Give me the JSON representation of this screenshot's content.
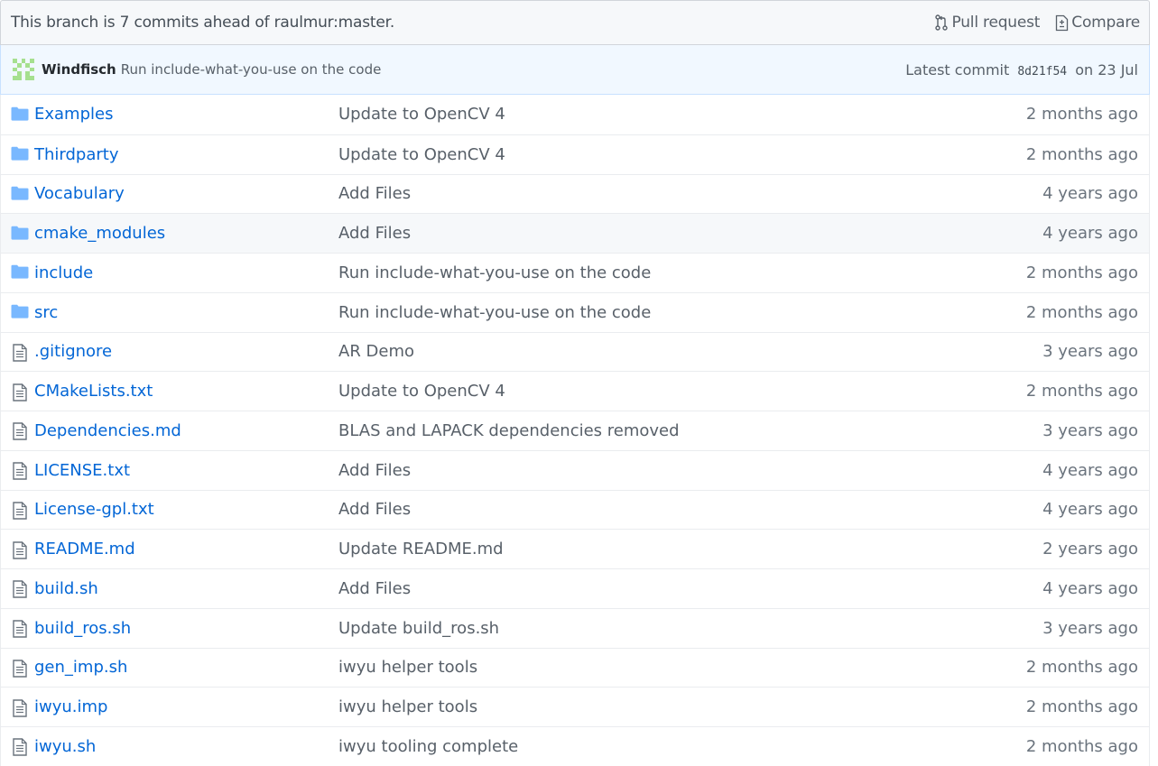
{
  "branch_bar": {
    "message": "This branch is 7 commits ahead of raulmur:master.",
    "pull_request_label": "Pull request",
    "pull_request_icon": "git-pull-request-icon",
    "compare_label": "Compare",
    "compare_icon": "file-diff-icon"
  },
  "commit": {
    "author": "Windfisch",
    "message": "Run include-what-you-use on the code",
    "latest_label": "Latest commit",
    "sha": "8d21f54",
    "date": "on 23 Jul"
  },
  "files": [
    {
      "type": "folder",
      "icon": "folder-icon",
      "name": "Examples",
      "message": "Update to OpenCV 4",
      "age": "2 months ago"
    },
    {
      "type": "folder",
      "icon": "folder-icon",
      "name": "Thirdparty",
      "message": "Update to OpenCV 4",
      "age": "2 months ago"
    },
    {
      "type": "folder",
      "icon": "folder-icon",
      "name": "Vocabulary",
      "message": "Add Files",
      "age": "4 years ago"
    },
    {
      "type": "folder",
      "icon": "folder-icon",
      "name": "cmake_modules",
      "message": "Add Files",
      "age": "4 years ago"
    },
    {
      "type": "folder",
      "icon": "folder-icon",
      "name": "include",
      "message": "Run include-what-you-use on the code",
      "age": "2 months ago"
    },
    {
      "type": "folder",
      "icon": "folder-icon",
      "name": "src",
      "message": "Run include-what-you-use on the code",
      "age": "2 months ago"
    },
    {
      "type": "file",
      "icon": "file-text-icon",
      "name": ".gitignore",
      "message": "AR Demo",
      "age": "3 years ago"
    },
    {
      "type": "file",
      "icon": "file-text-icon",
      "name": "CMakeLists.txt",
      "message": "Update to OpenCV 4",
      "age": "2 months ago"
    },
    {
      "type": "file",
      "icon": "file-text-icon",
      "name": "Dependencies.md",
      "message": "BLAS and LAPACK dependencies removed",
      "age": "3 years ago"
    },
    {
      "type": "file",
      "icon": "file-text-icon",
      "name": "LICENSE.txt",
      "message": "Add Files",
      "age": "4 years ago"
    },
    {
      "type": "file",
      "icon": "file-text-icon",
      "name": "License-gpl.txt",
      "message": "Add Files",
      "age": "4 years ago"
    },
    {
      "type": "file",
      "icon": "file-text-icon",
      "name": "README.md",
      "message": "Update README.md",
      "age": "2 years ago"
    },
    {
      "type": "file",
      "icon": "file-text-icon",
      "name": "build.sh",
      "message": "Add Files",
      "age": "4 years ago"
    },
    {
      "type": "file",
      "icon": "file-text-icon",
      "name": "build_ros.sh",
      "message": "Update build_ros.sh",
      "age": "3 years ago"
    },
    {
      "type": "file",
      "icon": "file-text-icon",
      "name": "gen_imp.sh",
      "message": "iwyu helper tools",
      "age": "2 months ago"
    },
    {
      "type": "file",
      "icon": "file-text-icon",
      "name": "iwyu.imp",
      "message": "iwyu helper tools",
      "age": "2 months ago"
    },
    {
      "type": "file",
      "icon": "file-text-icon",
      "name": "iwyu.sh",
      "message": "iwyu tooling complete",
      "age": "2 months ago"
    }
  ],
  "colors": {
    "link": "#0366d6",
    "folder_icon": "#79b8ff",
    "file_icon": "#6a737d",
    "commit_bar_bg": "#f1f8ff",
    "avatar": "#a6e08f"
  }
}
